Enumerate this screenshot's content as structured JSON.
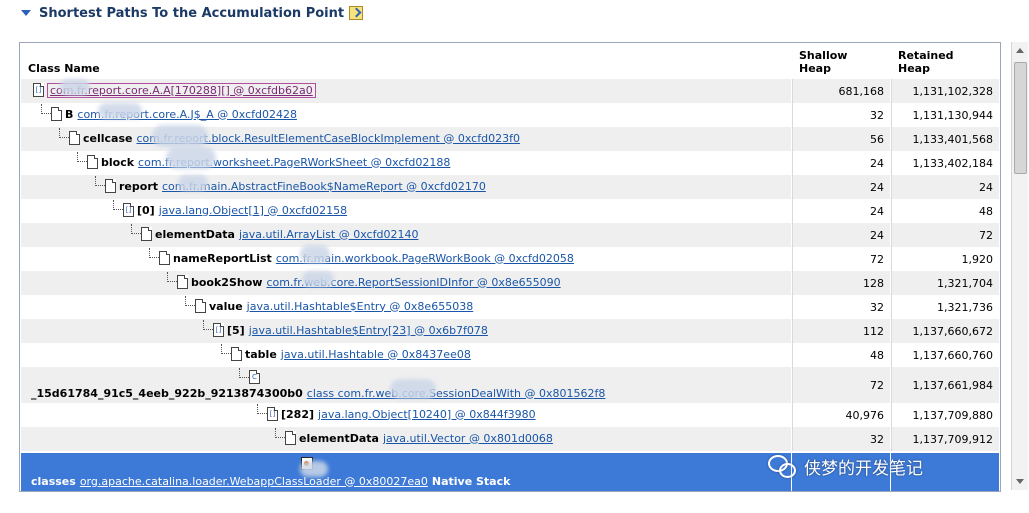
{
  "section": {
    "title": "Shortest Paths To the Accumulation Point"
  },
  "columns": {
    "class_name": "Class Name",
    "shallow_line1": "Shallow",
    "shallow_line2": "Heap",
    "retained_line1": "Retained",
    "retained_line2": "Heap"
  },
  "rows": [
    {
      "field": "",
      "cls": "com.fr.report.core.A.A[170288][] @ 0xcfdb62a0",
      "shallow": "681,168",
      "retained": "1,131,102,328"
    },
    {
      "field": "B",
      "cls": "com.fr.report.core.A.J$_A @ 0xcfd02428",
      "shallow": "32",
      "retained": "1,131,130,944"
    },
    {
      "field": "cellcase",
      "cls": "com.fr.report.block.ResultElementCaseBlockImplement @ 0xcfd023f0",
      "shallow": "56",
      "retained": "1,133,401,568"
    },
    {
      "field": "block",
      "cls": "com.fr.report.worksheet.PageRWorkSheet @ 0xcfd02188",
      "shallow": "24",
      "retained": "1,133,402,184"
    },
    {
      "field": "report",
      "cls": "com.fr.main.AbstractFineBook$NameReport @ 0xcfd02170",
      "shallow": "24",
      "retained": "24"
    },
    {
      "field": "[0]",
      "cls": "java.lang.Object[1] @ 0xcfd02158",
      "shallow": "24",
      "retained": "48"
    },
    {
      "field": "elementData",
      "cls": "java.util.ArrayList @ 0xcfd02140",
      "shallow": "24",
      "retained": "72"
    },
    {
      "field": "nameReportList",
      "cls": "com.fr.main.workbook.PageRWorkBook @ 0xcfd02058",
      "shallow": "72",
      "retained": "1,920"
    },
    {
      "field": "book2Show",
      "cls": "com.fr.web.core.ReportSessionIDInfor @ 0x8e655090",
      "shallow": "128",
      "retained": "1,321,704"
    },
    {
      "field": "value",
      "cls": "java.util.Hashtable$Entry @ 0x8e655038",
      "shallow": "32",
      "retained": "1,321,736"
    },
    {
      "field": "[5]",
      "cls": "java.util.Hashtable$Entry[23] @ 0x6b7f078",
      "shallow": "112",
      "retained": "1,137,660,672"
    },
    {
      "field": "table",
      "cls": "java.util.Hashtable @ 0x8437ee08",
      "shallow": "48",
      "retained": "1,137,660,760"
    },
    {
      "field": "_15d61784_91c5_4eeb_922b_9213874300b0",
      "cls": "class com.fr.web.core.SessionDealWith @ 0x801562f8",
      "shallow": "72",
      "retained": "1,137,661,984"
    },
    {
      "field": "[282]",
      "cls": "java.lang.Object[10240] @ 0x844f3980",
      "shallow": "40,976",
      "retained": "1,137,709,880"
    },
    {
      "field": "elementData",
      "cls": "java.util.Vector @ 0x801d0068",
      "shallow": "32",
      "retained": "1,137,709,912"
    },
    {
      "field": "classes",
      "cls": "org.apache.catalina.loader.WebappClassLoader @ 0x80027ea0",
      "suffix": "Native Stack",
      "shallow": "",
      "retained": ""
    }
  ],
  "watermark": {
    "text": "侠梦的开发笔记"
  }
}
